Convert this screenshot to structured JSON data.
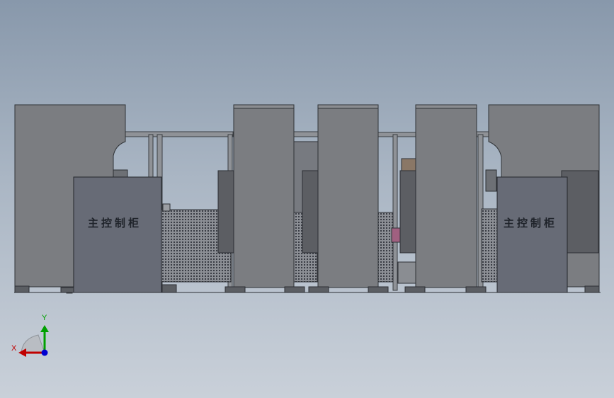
{
  "labels": {
    "left_cabinet": "主控制柜",
    "right_cabinet": "主控制柜"
  },
  "triad": {
    "x_label": "X",
    "y_label": "Y"
  },
  "colors": {
    "background_top": "#8898ab",
    "background_bottom": "#c9d0d9",
    "cabinet_fill": "#7b7d81",
    "control_cabinet_fill": "#676b76",
    "frame_stroke": "#3a3d42",
    "axis_x": "#c00000",
    "axis_y": "#00a000",
    "axis_z": "#0000d0"
  }
}
